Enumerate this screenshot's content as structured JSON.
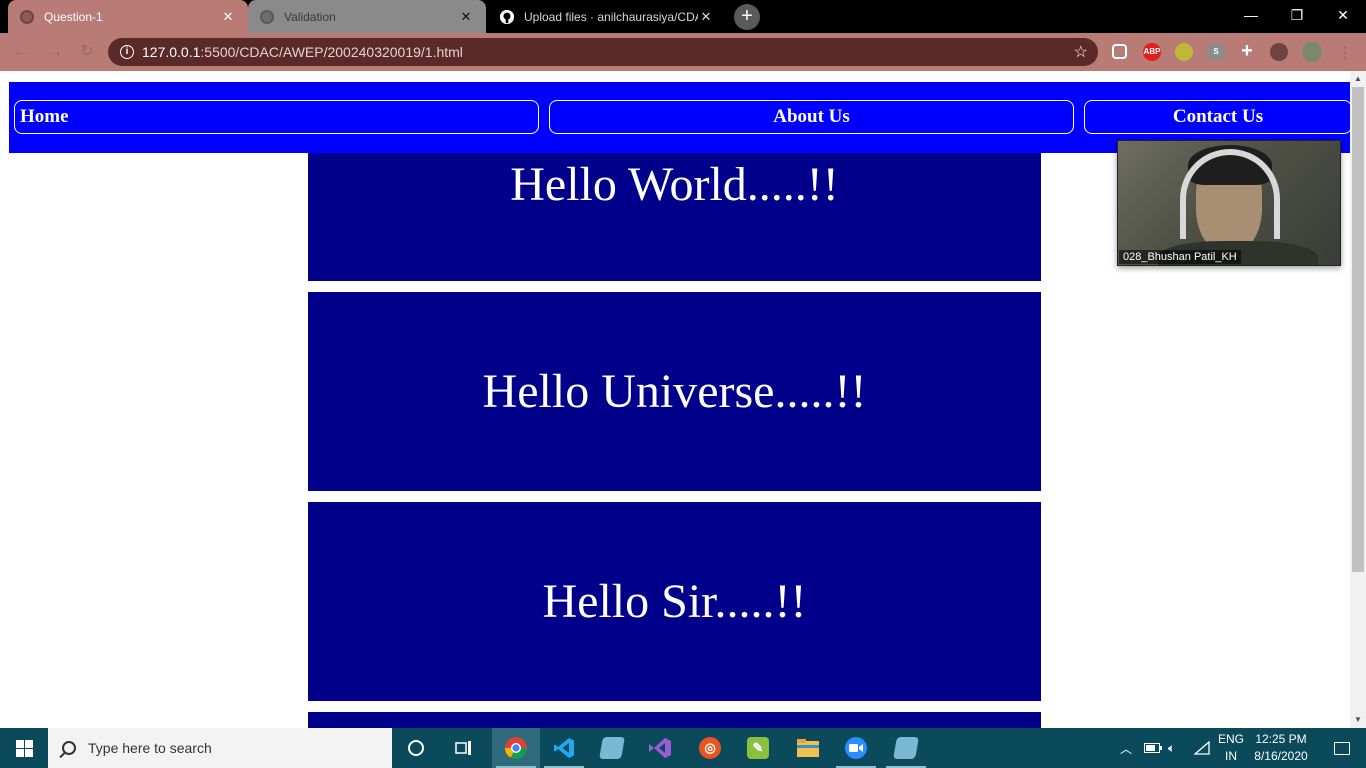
{
  "browser": {
    "tabs": [
      {
        "title": "Question-1",
        "close": "✕"
      },
      {
        "title": "Validation",
        "close": "✕"
      },
      {
        "title": "Upload files · anilchaurasiya/CDA",
        "close": "✕"
      }
    ],
    "new_tab": "+",
    "window_controls": {
      "minimize": "—",
      "restore": "❐",
      "close": "✕"
    },
    "address": {
      "host": "127.0.0.1",
      "rest": ":5500/CDAC/AWEP/200240320019/1.html"
    },
    "extensions": [
      {
        "name": "reading-list-icon",
        "color": "#ffffff"
      },
      {
        "name": "adblock-icon",
        "label": "ABP",
        "color": "#e0201a"
      },
      {
        "name": "extension-green-icon",
        "color": "#c0b63a"
      },
      {
        "name": "extension-s-icon",
        "label": "S",
        "color": "#8c8c8c"
      }
    ]
  },
  "page": {
    "nav": {
      "home": "Home",
      "about": "About Us",
      "contact": "Contact Us"
    },
    "cards": [
      "Hello World.....!!",
      "Hello Universe.....!!",
      "Hello Sir.....!!"
    ],
    "colors": {
      "nav_bg": "#0000ff",
      "card_bg": "#00008b"
    }
  },
  "video": {
    "participant": "028_Bhushan Patil_KH"
  },
  "taskbar": {
    "search_placeholder": "Type here to search",
    "lang": {
      "line1": "ENG",
      "line2": "IN"
    },
    "time": "12:25 PM",
    "date": "8/16/2020"
  }
}
